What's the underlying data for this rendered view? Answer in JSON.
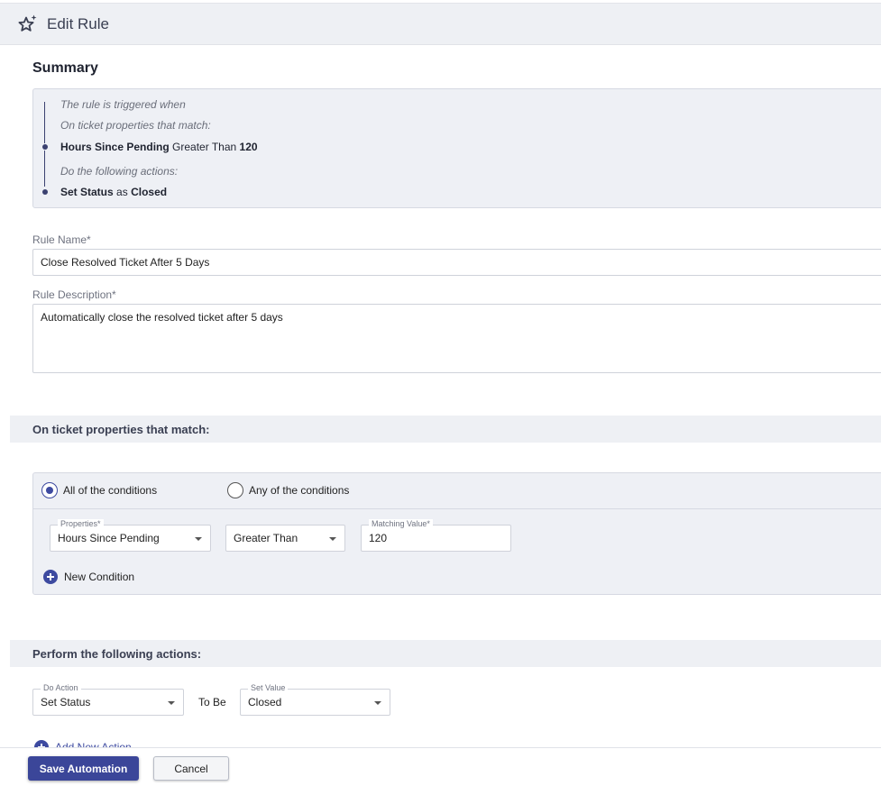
{
  "header": {
    "title": "Edit Rule",
    "icon": "star-sparkle-icon"
  },
  "summary": {
    "title": "Summary",
    "triggered_text": "The rule is triggered when",
    "match_text": "On ticket properties that match:",
    "condition": {
      "property": "Hours Since Pending",
      "operator": "Greater Than",
      "value": "120"
    },
    "actions_text": "Do the following actions:",
    "action": {
      "name": "Set Status",
      "connector": "as",
      "value": "Closed"
    }
  },
  "form": {
    "rule_name_label": "Rule Name*",
    "rule_name_value": "Close Resolved Ticket After 5 Days",
    "rule_description_label": "Rule Description*",
    "rule_description_value": "Automatically close the resolved ticket after 5 days"
  },
  "conditions_section": {
    "title": "On ticket properties that match:",
    "all_label": "All of the conditions",
    "any_label": "Any of the conditions",
    "selected": "all",
    "properties_label": "Properties*",
    "properties_value": "Hours Since Pending",
    "operator_value": "Greater Than",
    "matching_label": "Matching Value*",
    "matching_value": "120",
    "new_condition_label": "New Condition"
  },
  "actions_section": {
    "title": "Perform the following actions:",
    "do_action_label": "Do Action",
    "do_action_value": "Set Status",
    "to_be_label": "To Be",
    "set_value_label": "Set Value",
    "set_value_value": "Closed",
    "add_action_label": "Add New Action"
  },
  "footer": {
    "save_label": "Save Automation",
    "cancel_label": "Cancel"
  },
  "colors": {
    "accent": "#3b4699",
    "header_bg": "#eef0f4",
    "panel_bg": "#eef0f5"
  }
}
